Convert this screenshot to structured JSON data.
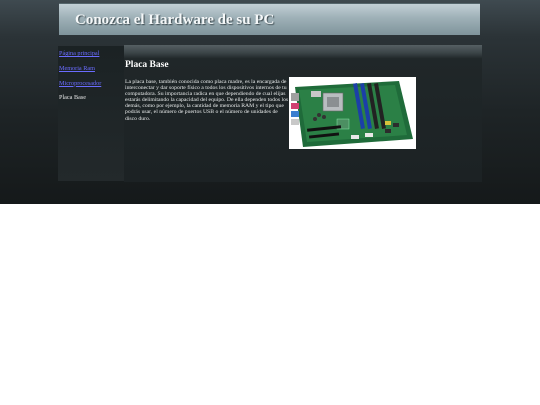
{
  "header": {
    "title": "Conozca el Hardware de su PC"
  },
  "nav": {
    "items": [
      {
        "label": "Página principal",
        "link": true
      },
      {
        "label": "Memoria Ram",
        "link": true
      },
      {
        "label": "Microprocesador",
        "link": true
      },
      {
        "label": "Placa Base",
        "link": false
      }
    ]
  },
  "main": {
    "heading": "Placa Base",
    "paragraph": "La placa base, también conocida como placa madre, es la encargada de interconectar y dar soporte físico a todos los dispositivos internos de tu computadora. Su importancia radica en que dependiendo de cual elijas estarás delimitando la capacidad del equipo. De ella dependen todos los demás, como por ejemplo, la cantidad de memoria RAM y el tipo que podrás usar, el número de puertos USB o el número de unidades de disco duro."
  }
}
